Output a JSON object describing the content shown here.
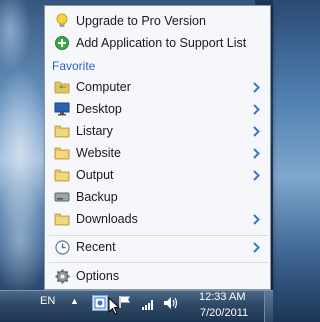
{
  "menu": {
    "top_items": [
      {
        "label": "Upgrade to Pro Version",
        "icon": "lightbulb-icon"
      },
      {
        "label": "Add Application to Support List",
        "icon": "add-circle-icon"
      }
    ],
    "section_title": "Favorite",
    "favorites": [
      {
        "label": "Computer",
        "icon": "computer-folder-icon",
        "has_submenu": true
      },
      {
        "label": "Desktop",
        "icon": "desktop-monitor-icon",
        "has_submenu": true
      },
      {
        "label": "Listary",
        "icon": "folder-icon",
        "has_submenu": true
      },
      {
        "label": "Website",
        "icon": "folder-icon",
        "has_submenu": true
      },
      {
        "label": "Output",
        "icon": "folder-icon",
        "has_submenu": true
      },
      {
        "label": "Backup",
        "icon": "drive-icon",
        "has_submenu": false
      },
      {
        "label": "Downloads",
        "icon": "folder-icon",
        "has_submenu": true
      }
    ],
    "recent": {
      "label": "Recent",
      "icon": "clock-icon",
      "has_submenu": true
    },
    "options": {
      "label": "Options",
      "icon": "gear-icon"
    }
  },
  "taskbar": {
    "language": "EN",
    "show_hidden_arrow": "▲",
    "clock_time": "12:33 AM",
    "clock_date": "7/20/2011"
  },
  "colors": {
    "accent": "#2a63c7",
    "chevron": "#3b73c8",
    "folder": "#e8c35a",
    "menu_bg": "#f5f7fa"
  }
}
